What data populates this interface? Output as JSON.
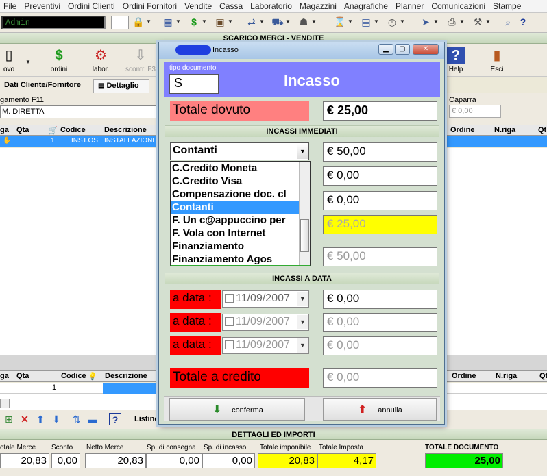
{
  "menu": [
    "File",
    "Preventivi",
    "Ordini Clienti",
    "Ordini Fornitori",
    "Vendite",
    "Cassa",
    "Laboratorio",
    "Magazzini",
    "Anagrafiche",
    "Planner",
    "Comunicazioni",
    "Stampe"
  ],
  "toolbar": {
    "user": "Admin"
  },
  "background": {
    "window_title": "SCARICO MERCI - VENDITE",
    "buttons": [
      {
        "label": "ovo",
        "icon": "new-icon"
      },
      {
        "label": "ordini",
        "icon": "dollar-icon"
      },
      {
        "label": "labor.",
        "icon": "lab-icon"
      },
      {
        "label": "scontr. F3",
        "icon": "receipt-icon"
      },
      {
        "label": "Help",
        "icon": "help-icon"
      },
      {
        "label": "Esci",
        "icon": "exit-icon"
      }
    ],
    "tabs": [
      "Dati Cliente/Fornitore",
      "Dettaglio"
    ],
    "pagamento_label": "gamento F11",
    "pagamento_value": "M. DIRETTA",
    "caparra_label": "Caparra",
    "caparra_value": "€ 0,00",
    "grid_headers": [
      "ga",
      "Qta",
      "Codice",
      "Descrizione",
      "Ordine",
      "N.riga",
      "Qt"
    ],
    "grid_row": {
      "qta": "1",
      "codice": "INST.OS",
      "descrizione": "INSTALLAZIONE"
    },
    "grid2_headers": [
      "ga",
      "Qta",
      "Codice",
      "Descrizione",
      "Ordine",
      "N.riga",
      "Qt"
    ],
    "grid2_row": {
      "qta": "1"
    },
    "listino_label": "Listino",
    "details_title": "DETTAGLI ED IMPORTI",
    "details": [
      {
        "label": "otale Merce",
        "value": "20,83"
      },
      {
        "label": "Sconto",
        "value": "0,00"
      },
      {
        "label": "Netto Merce",
        "value": "20,83"
      },
      {
        "label": "Sp. di consegna",
        "value": "0,00"
      },
      {
        "label": "Sp. di incasso",
        "value": "0,00"
      },
      {
        "label": "Totale imponibile",
        "value": "20,83"
      },
      {
        "label": "Totale Imposta",
        "value": "4,17"
      },
      {
        "label": "TOTALE DOCUMENTO",
        "value": "25,00"
      }
    ]
  },
  "dialog": {
    "title": "Incasso",
    "tipo_documento_label": "tipo documento",
    "tipo_documento_value": "S",
    "header": "Incasso",
    "totale_dovuto_label": "Totale dovuto",
    "totale_dovuto_value": "€ 25,00",
    "incassi_immediati_title": "INCASSI IMMEDIATI",
    "combo_value": "Contanti",
    "dropdown_options": [
      "C.Credito Moneta",
      "C.Credito Visa",
      "Compensazione doc. cl",
      "Contanti",
      "F. Un c@appuccino per",
      "F. Vola con Internet",
      "Finanziamento",
      "Finanziamento Agos"
    ],
    "dropdown_selected": "Contanti",
    "immediate_values": [
      "€ 50,00",
      "€ 0,00",
      "€ 0,00",
      "€ 25,00",
      "€ 50,00"
    ],
    "incassi_a_data_title": "INCASSI A DATA",
    "a_data_rows": [
      {
        "label": "a data :",
        "date": "11/09/2007",
        "value": "€ 0,00"
      },
      {
        "label": "a data :",
        "date": "11/09/2007",
        "value": "€ 0,00"
      },
      {
        "label": "a data :",
        "date": "11/09/2007",
        "value": "€ 0,00"
      }
    ],
    "totale_credito_label": "Totale a credito",
    "totale_credito_value": "€ 0,00",
    "conferma_label": "conferma",
    "annulla_label": "annulla"
  },
  "colors": {
    "accent_blue": "#8080ff",
    "due_red": "#ff8080",
    "date_red": "#ff0000",
    "highlight_yellow": "#ffff00",
    "total_green": "#00ee00",
    "selection_blue": "#3399ff"
  }
}
